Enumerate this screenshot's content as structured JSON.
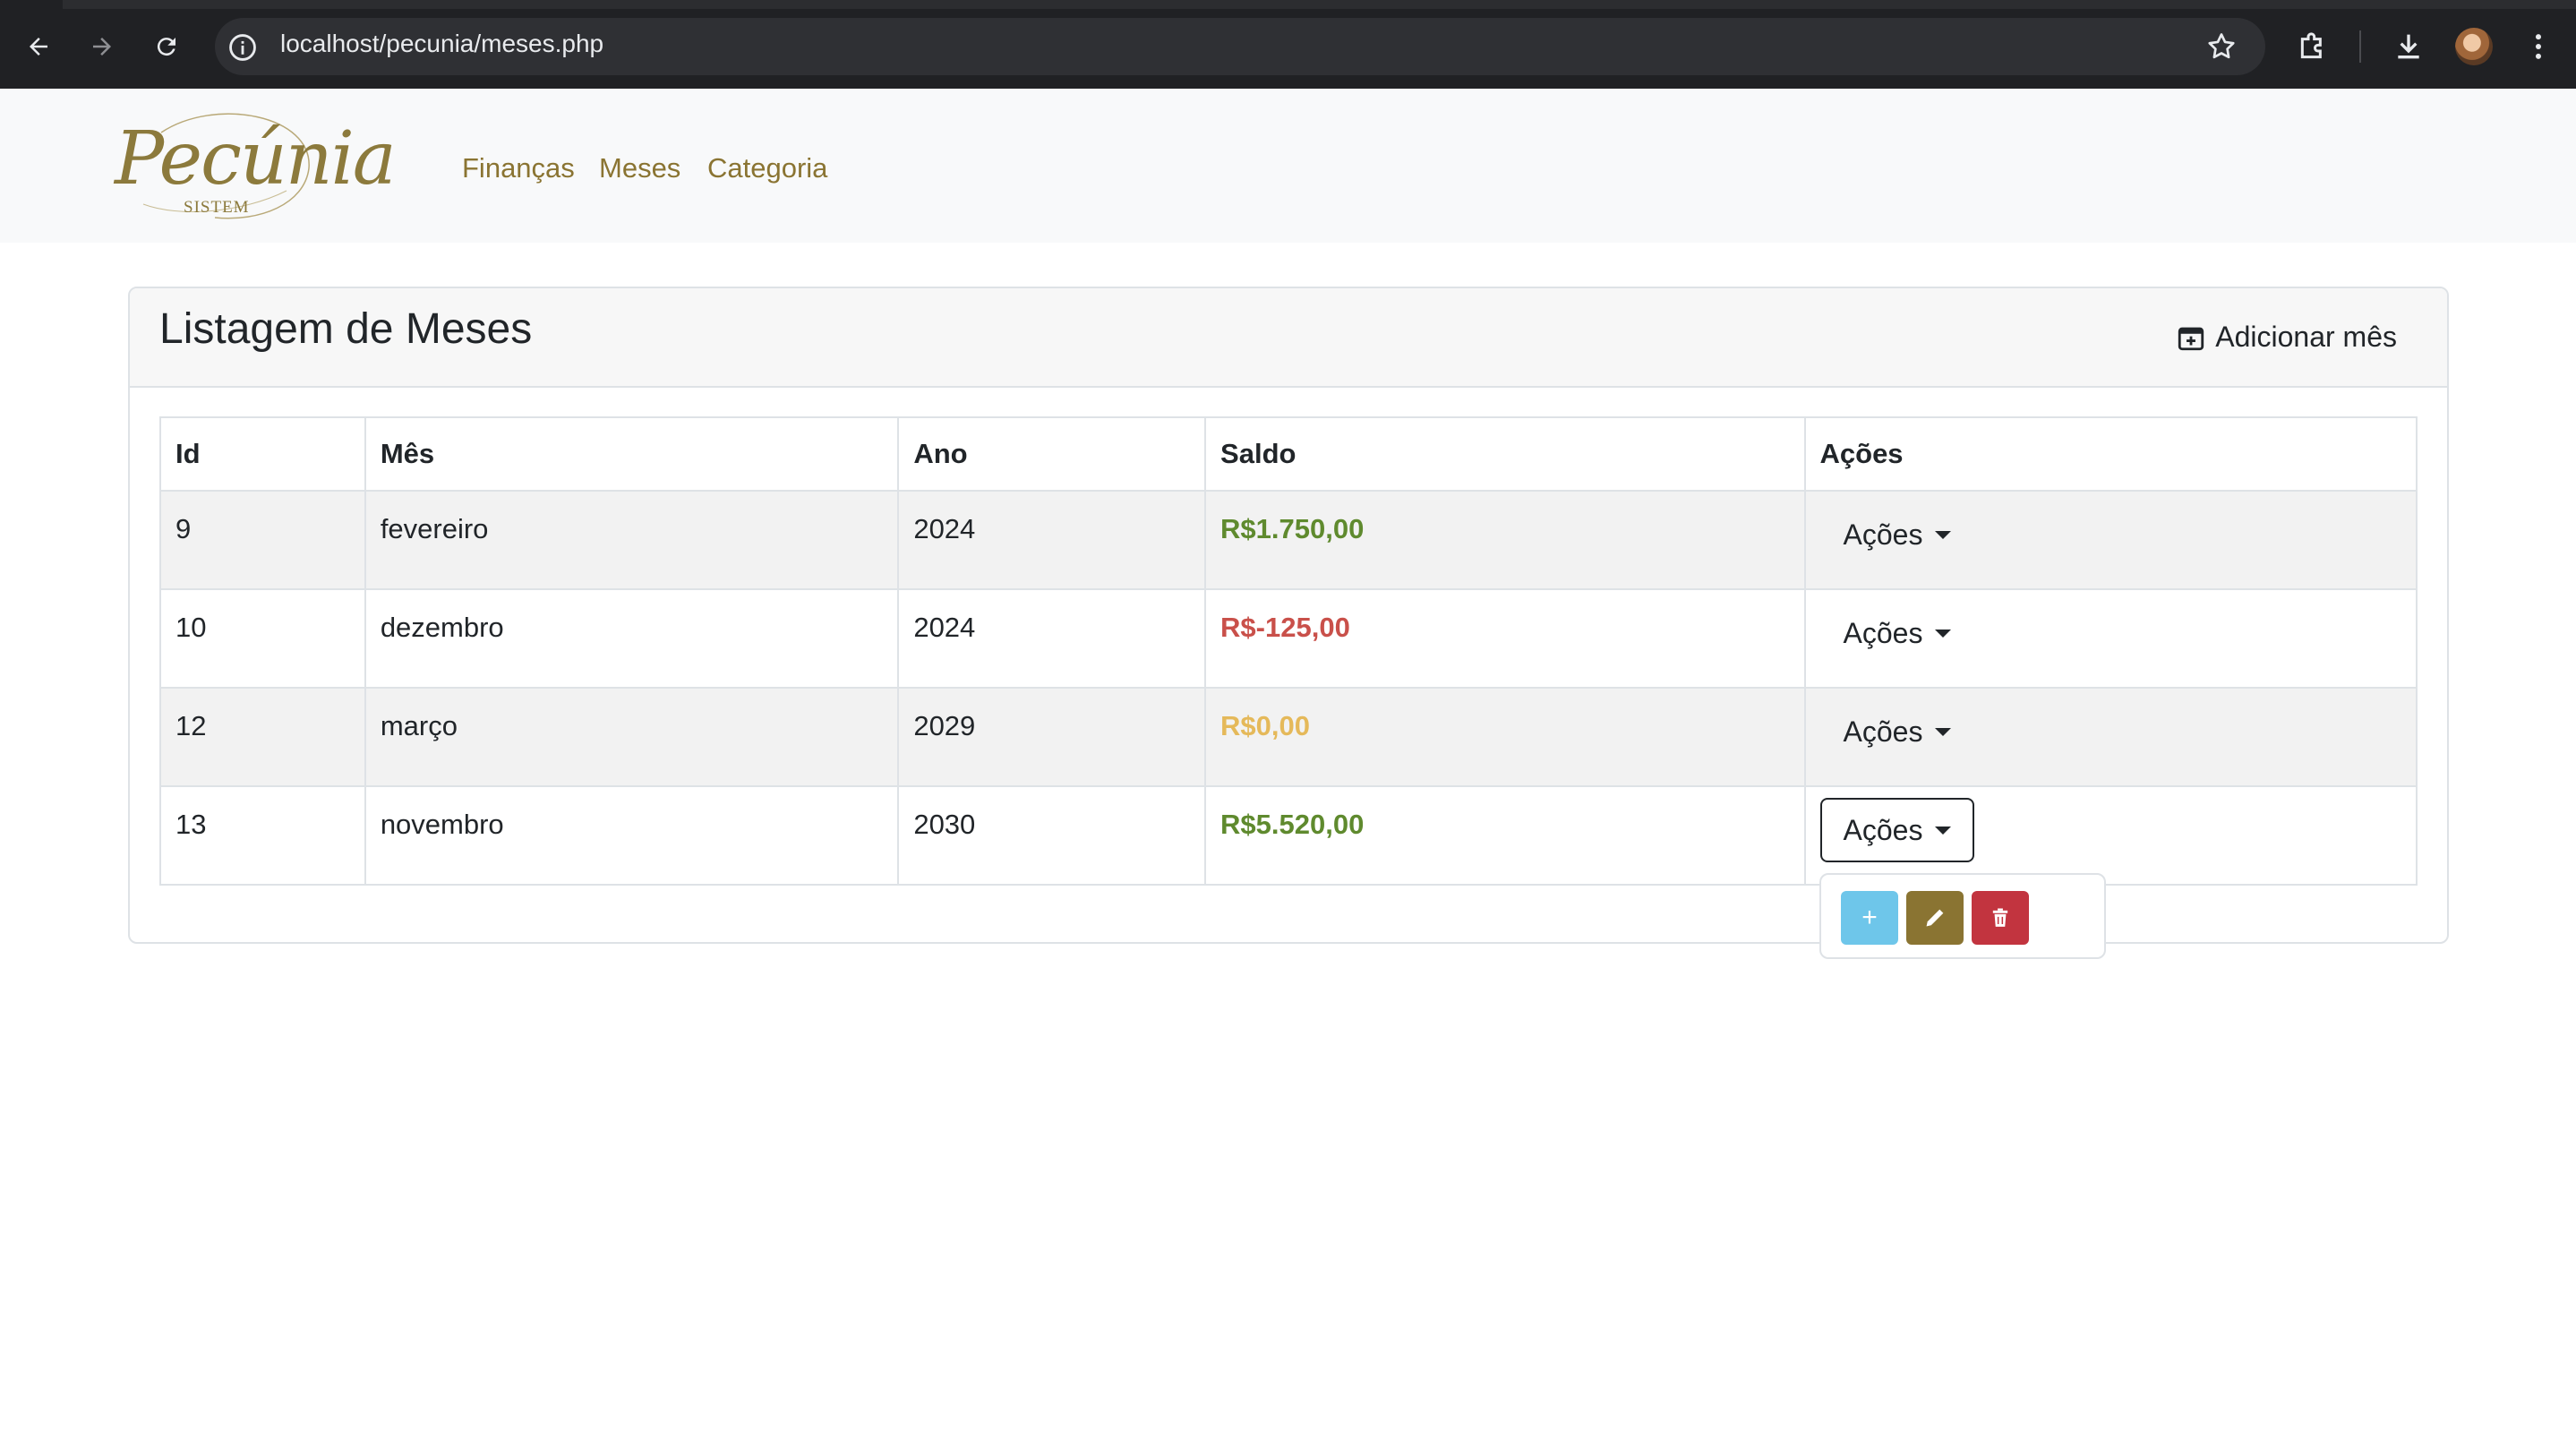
{
  "browser": {
    "url": "localhost/pecunia/meses.php"
  },
  "navbar": {
    "logo_text": "Pecúnia",
    "logo_subtitle": "SISTEM",
    "links": [
      "Finanças",
      "Meses",
      "Categoria"
    ]
  },
  "card": {
    "title": "Listagem de Meses",
    "add_button": "Adicionar mês"
  },
  "table": {
    "headers": [
      "Id",
      "Mês",
      "Ano",
      "Saldo",
      "Ações"
    ],
    "rows": [
      {
        "id": "9",
        "mes": "fevereiro",
        "ano": "2024",
        "saldo": "R$1.750,00",
        "saldo_color": "#5f8a2e",
        "acoes": "Ações"
      },
      {
        "id": "10",
        "mes": "dezembro",
        "ano": "2024",
        "saldo": "R$-125,00",
        "saldo_color": "#c9504a",
        "acoes": "Ações"
      },
      {
        "id": "12",
        "mes": "março",
        "ano": "2029",
        "saldo": "R$0,00",
        "saldo_color": "#e5b95a",
        "acoes": "Ações"
      },
      {
        "id": "13",
        "mes": "novembro",
        "ano": "2030",
        "saldo": "R$5.520,00",
        "saldo_color": "#5f8a2e",
        "acoes": "Ações"
      }
    ]
  },
  "dropdown": {
    "add_label": "+",
    "colors": {
      "add": "#6ec6ea",
      "edit": "#8a7432",
      "delete": "#c2343f"
    }
  },
  "icons": {
    "back": "arrow-left-icon",
    "forward": "arrow-right-icon",
    "reload": "reload-icon",
    "site_info": "info-icon",
    "bookmark": "star-icon",
    "extensions": "puzzle-icon",
    "download": "download-icon",
    "menu": "kebab-menu-icon",
    "add_month": "calendar-plus-icon",
    "edit": "pencil-icon",
    "delete": "trash-icon"
  }
}
